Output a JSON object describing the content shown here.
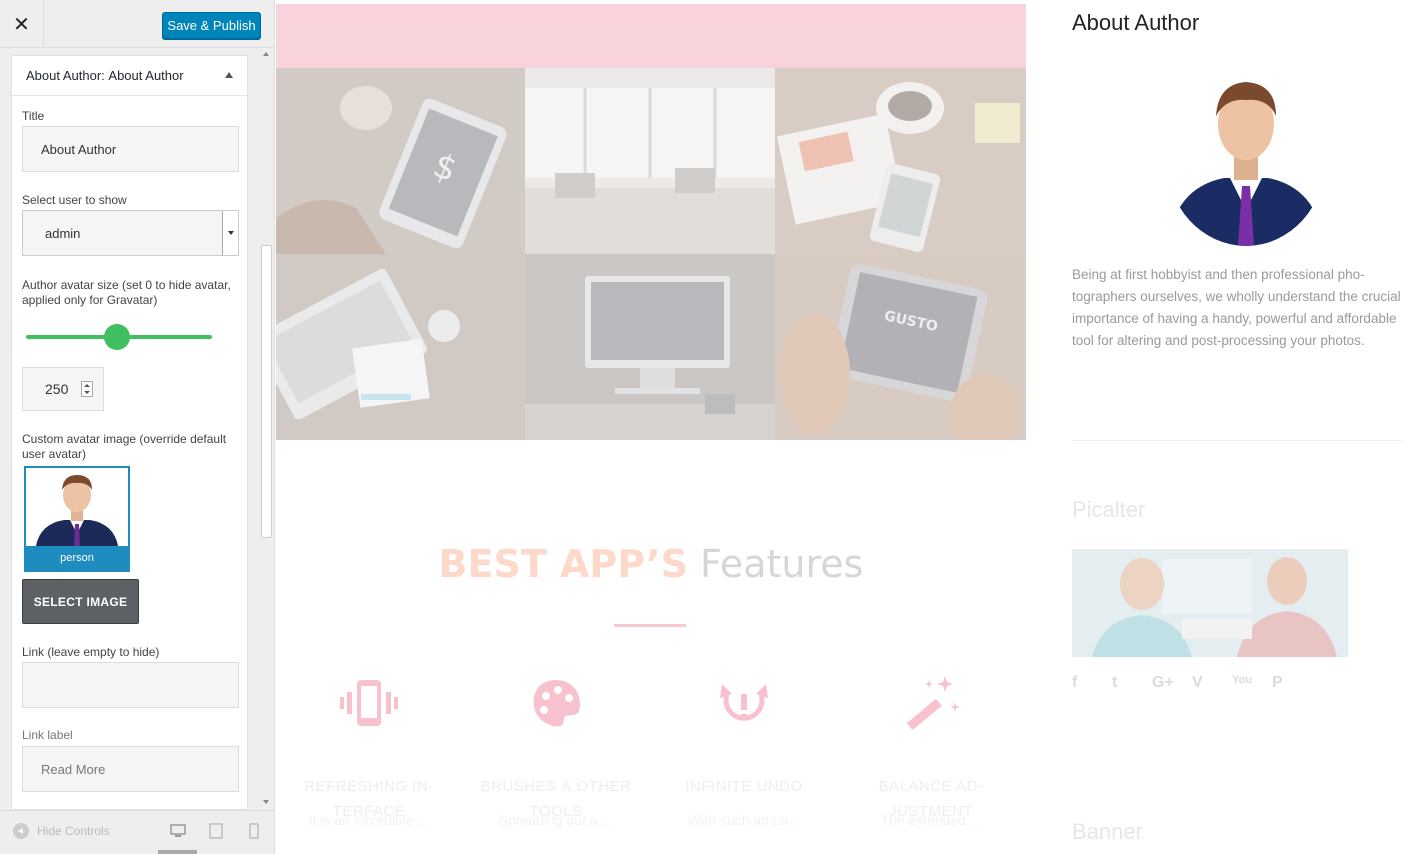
{
  "header": {
    "close_glyph": "✕",
    "publish_label": "Save & Publish"
  },
  "section": {
    "title_prefix": "About Author:",
    "title_value": "About Author"
  },
  "fields": {
    "title_label": "Title",
    "title_value": "About Author",
    "user_label": "Select user to show",
    "user_value": "admin",
    "avatar_size_label": "Author avatar size (set 0 to hide avatar, applied only for Gravatar)",
    "avatar_size_value": "250",
    "avatar_size_slider_fraction": 0.49,
    "custom_avatar_label": "Custom avatar image (override default user avatar)",
    "custom_avatar_filename": "person",
    "select_image_label": "SELECT IMAGE",
    "link_label": "Link (leave empty to hide)",
    "link_value": "",
    "link_label_label": "Link label",
    "link_label_placeholder": "Read More"
  },
  "footer": {
    "hide_controls_label": "Hide Controls",
    "devices": [
      "desktop-icon",
      "tablet-icon",
      "mobile-icon"
    ],
    "active_device": "desktop"
  },
  "preview": {
    "features_heading_highlight": "BEST APP’S",
    "features_heading_rest": "Features",
    "features": [
      {
        "icon": "phone-vibrate-icon",
        "title": "REFRESHING IN-TERFACE",
        "desc": "It is an incredible ..."
      },
      {
        "icon": "palette-icon",
        "title": "BRUSHES & OTHER TOOLS",
        "desc": "Spreading out a ..."
      },
      {
        "icon": "undo-icon",
        "title": "INFINITE UNDO",
        "desc": "With such an un..."
      },
      {
        "icon": "magic-wand-icon",
        "title": "BALANCE AD-JUSTMENT",
        "desc": "The extended ..."
      }
    ]
  },
  "widgets": {
    "about_title": "About Author",
    "about_text": "Being at first hobbyist and then professional pho-tographers ourselves, we wholly understand the crucial importance of having a handy, powerful and affordable tool for altering and post-processing your photos.",
    "picalter_title": "Picalter",
    "social": [
      "f",
      "t",
      "G+",
      "V",
      "You",
      "P"
    ],
    "banner_title": "Banner"
  },
  "colors": {
    "accent_blue": "#0085ba",
    "slider_green": "#3fbf5f",
    "pink_bar": "#f8d3dc",
    "feature_pink": "#f5a3b5"
  }
}
